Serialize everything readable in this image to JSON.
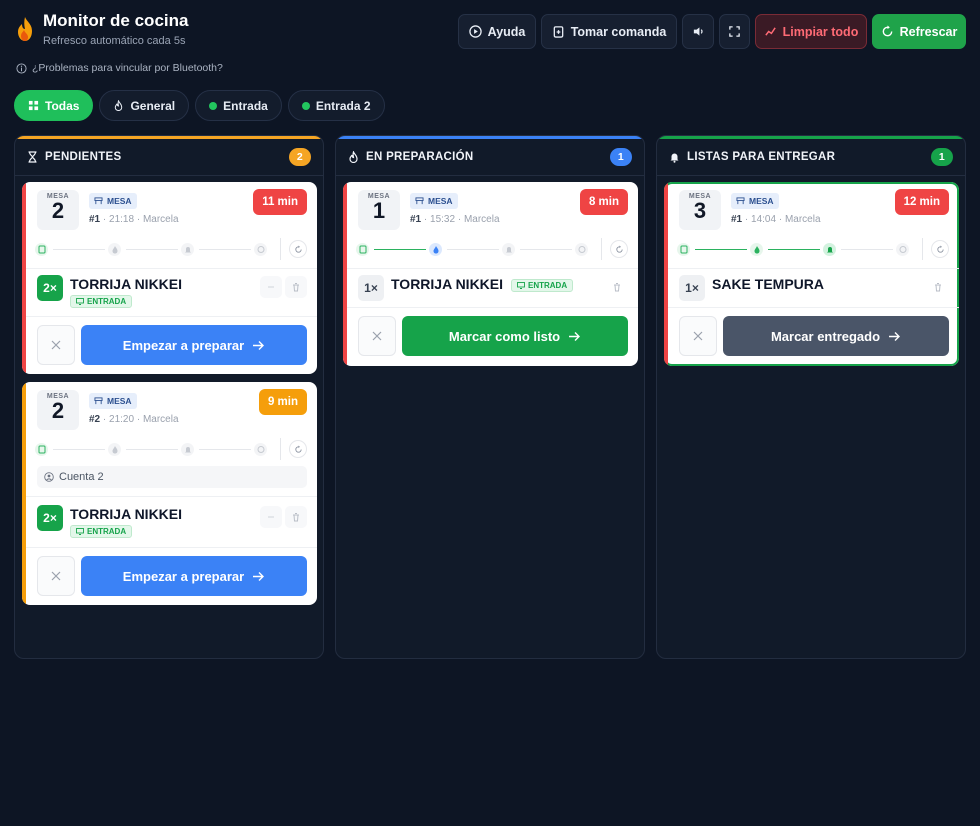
{
  "header": {
    "title": "Monitor de cocina",
    "subtitle": "Refresco automático cada 5s",
    "help_label": "Ayuda",
    "order_label": "Tomar comanda",
    "clear_label": "Limpiar todo",
    "refresh_label": "Refrescar"
  },
  "bluetooth_note": "¿Problemas para vincular por Bluetooth?",
  "filters": [
    {
      "label": "Todas",
      "icon": "grid-icon",
      "active": true
    },
    {
      "label": "General",
      "icon": "flame-icon",
      "active": false
    },
    {
      "label": "Entrada",
      "icon": "green-dot",
      "active": false
    },
    {
      "label": "Entrada 2",
      "icon": "green-dot",
      "active": false
    }
  ],
  "columns": [
    {
      "title": "PENDIENTES",
      "count": "2",
      "accent": "#f5a524",
      "cards": [
        {
          "mesa_label": "MESA",
          "mesa": "2",
          "type": "MESA",
          "order": "#1",
          "time": "21:18",
          "waiter": "Marcela",
          "timer": "11 min",
          "timer_color": "#ef4444",
          "item_qty": "2×",
          "item_name": "TORRIJA NIKKEI",
          "item_tag": "ENTRADA",
          "action": "Empezar a preparar",
          "bar": "#ef4444"
        },
        {
          "mesa_label": "MESA",
          "mesa": "2",
          "type": "MESA",
          "order": "#2",
          "time": "21:20",
          "waiter": "Marcela",
          "timer": "9 min",
          "timer_color": "#f59e0b",
          "account": "Cuenta 2",
          "item_qty": "2×",
          "item_name": "TORRIJA NIKKEI",
          "item_tag": "ENTRADA",
          "action": "Empezar a preparar",
          "bar": "#f59e0b"
        }
      ]
    },
    {
      "title": "EN PREPARACIÓN",
      "count": "1",
      "accent": "#3b82f6",
      "cards": [
        {
          "mesa_label": "MESA",
          "mesa": "1",
          "type": "MESA",
          "order": "#1",
          "time": "15:32",
          "waiter": "Marcela",
          "timer": "8 min",
          "timer_color": "#ef4444",
          "item_qty": "1×",
          "item_name": "TORRIJA NIKKEI",
          "item_tag": "ENTRADA",
          "action": "Marcar como listo",
          "bar": "#ef4444"
        }
      ]
    },
    {
      "title": "LISTAS PARA ENTREGAR",
      "count": "1",
      "accent": "#16a34a",
      "cards": [
        {
          "mesa_label": "MESA",
          "mesa": "3",
          "type": "MESA",
          "order": "#1",
          "time": "14:04",
          "waiter": "Marcela",
          "timer": "12 min",
          "timer_color": "#ef4444",
          "item_qty": "1×",
          "item_name": "SAKE TEMPURA",
          "action": "Marcar entregado",
          "bar": "#ef4444"
        }
      ]
    }
  ],
  "colors": {
    "background": "#0d1524",
    "pending": "#f5a524",
    "preparing": "#3b82f6",
    "ready": "#16a34a",
    "primary_button": "#3b82f6",
    "ready_button": "#16a34a",
    "delivered_button": "#4a5568"
  }
}
